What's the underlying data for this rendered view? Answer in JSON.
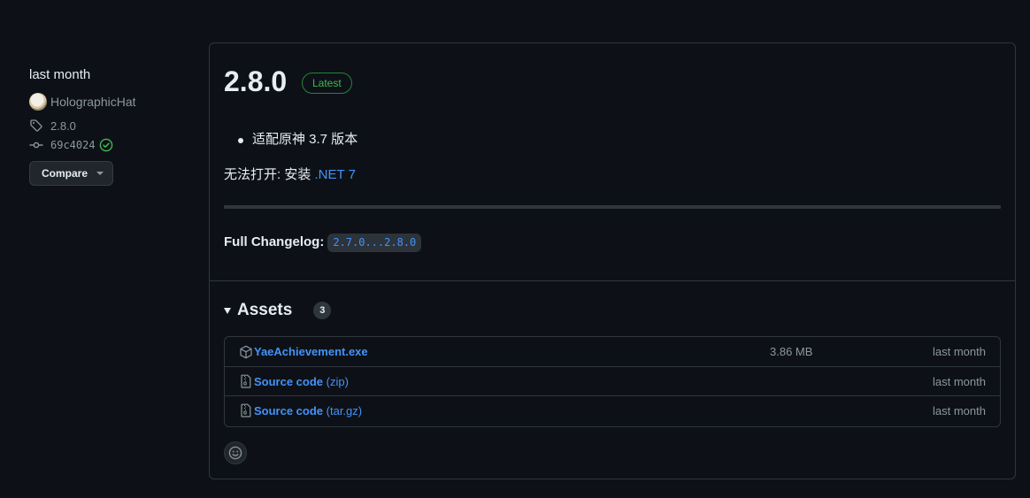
{
  "sidebar": {
    "time": "last month",
    "author": "HolographicHat",
    "tag": "2.8.0",
    "commit": "69c4024",
    "compare_label": "Compare"
  },
  "release": {
    "title": "2.8.0",
    "badge": "Latest",
    "notes": [
      "适配原神 3.7 版本"
    ],
    "fail_text": "无法打开: 安装 ",
    "fail_link": ".NET 7",
    "changelog_label": "Full Changelog:",
    "changelog_link": "2.7.0...2.8.0"
  },
  "assets": {
    "title": "Assets",
    "count": "3",
    "items": [
      {
        "name": "YaeAchievement.exe",
        "suffix": "",
        "size": "3.86 MB",
        "date": "last month",
        "icon": "package-icon"
      },
      {
        "name": "Source code",
        "suffix": " (zip)",
        "size": "",
        "date": "last month",
        "icon": "file-zip-icon"
      },
      {
        "name": "Source code",
        "suffix": " (tar.gz)",
        "size": "",
        "date": "last month",
        "icon": "file-zip-icon"
      }
    ]
  },
  "colors": {
    "background": "#0d1117",
    "link": "#4493f8",
    "latest_green": "#3fb950",
    "border": "#30363d",
    "muted": "#8d96a0"
  }
}
